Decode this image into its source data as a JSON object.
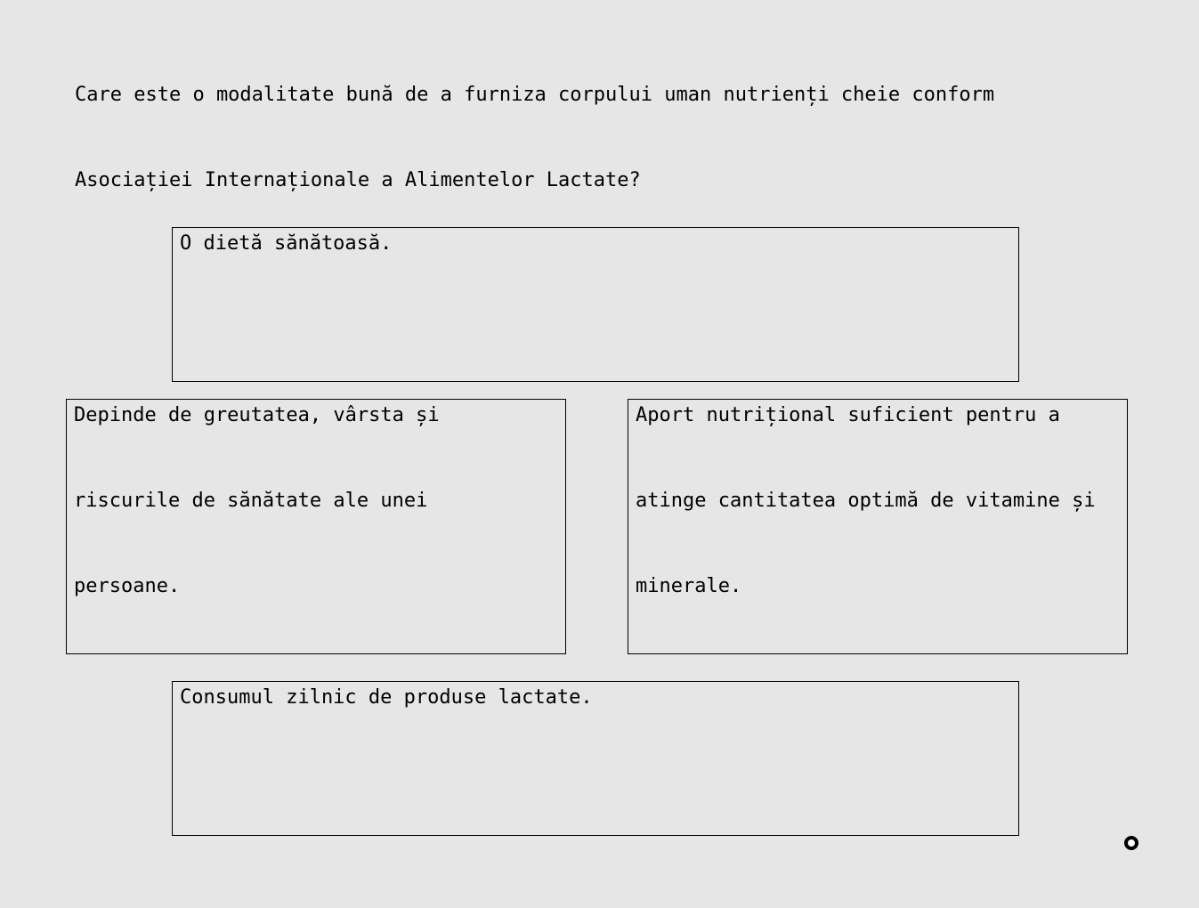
{
  "question": {
    "lines": [
      "Care este o modalitate bună de a furniza corpului uman nutrienți cheie conform",
      "Asociației Internaționale a Alimentelor Lactate?"
    ]
  },
  "options": [
    {
      "id": "a",
      "lines": [
        "O dietă sănătoasă."
      ]
    },
    {
      "id": "b",
      "lines": [
        "Depinde de greutatea, vârsta și",
        "riscurile de sănătate ale unei",
        "persoane."
      ]
    },
    {
      "id": "c",
      "lines": [
        "Aport nutrițional suficient pentru a",
        "atinge cantitatea optimă de vitamine și",
        "minerale."
      ]
    },
    {
      "id": "d",
      "lines": [
        "Consumul zilnic de produse lactate."
      ]
    }
  ],
  "cursor": {
    "icon": "cursor-ring-icon"
  }
}
